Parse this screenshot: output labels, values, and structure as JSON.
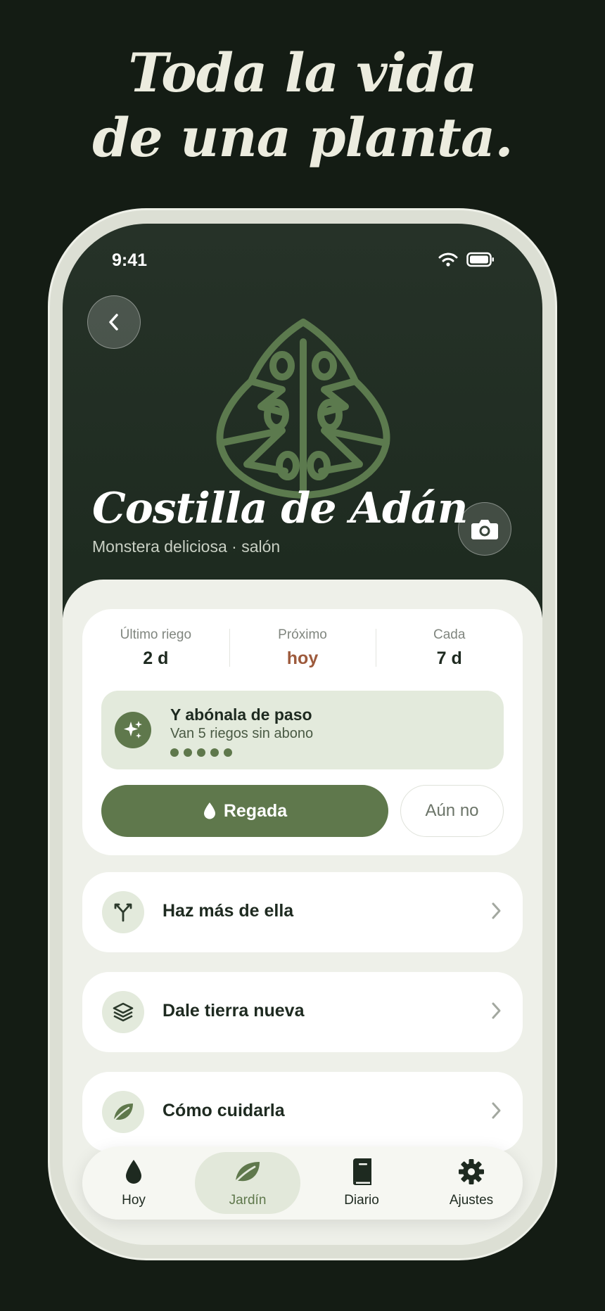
{
  "headline": {
    "line1": "Toda la vida",
    "line2": "de una planta."
  },
  "status_bar": {
    "time": "9:41",
    "icons": [
      "wifi-icon",
      "battery-icon"
    ]
  },
  "plant": {
    "name": "Costilla de Adán",
    "subtitle": "Monstera deliciosa · salón"
  },
  "stats": [
    {
      "label": "Último riego",
      "value": "2 d"
    },
    {
      "label": "Próximo",
      "value": "hoy"
    },
    {
      "label": "Cada",
      "value": "7 d"
    }
  ],
  "tip": {
    "title": "Y abónala de paso",
    "subtitle": "Van 5 riegos sin abono",
    "dots": 5,
    "icon": "sparkles-icon"
  },
  "actions": {
    "primary_label": "Regada",
    "secondary_label": "Aún no"
  },
  "rows": [
    {
      "label": "Haz más de ella",
      "icon": "propagate-icon"
    },
    {
      "label": "Dale tierra nueva",
      "icon": "layers-icon"
    },
    {
      "label": "Cómo cuidarla",
      "icon": "leaf-icon"
    }
  ],
  "tabs": [
    {
      "label": "Hoy",
      "icon": "drop-icon"
    },
    {
      "label": "Jardín",
      "icon": "leaf-icon",
      "active": true
    },
    {
      "label": "Diario",
      "icon": "book-icon"
    },
    {
      "label": "Ajustes",
      "icon": "gear-icon"
    }
  ],
  "colors": {
    "background": "#141c14",
    "accent_green": "#5f784c",
    "accent_rust": "#9d5a3c",
    "hero": "#263228"
  }
}
